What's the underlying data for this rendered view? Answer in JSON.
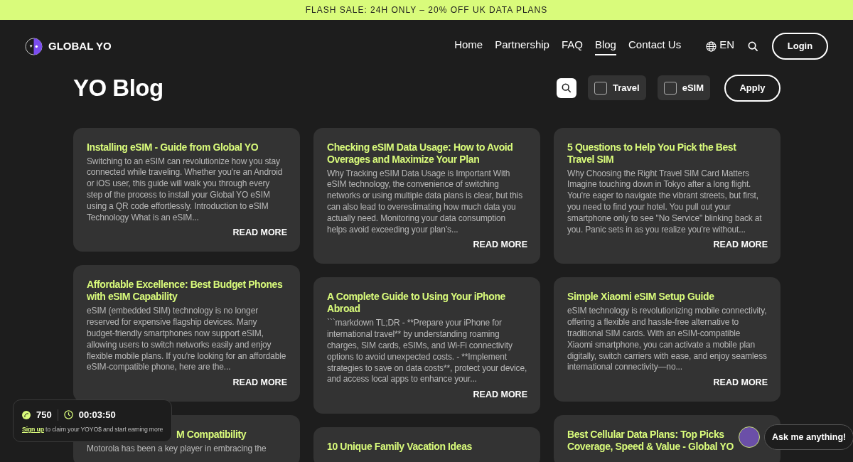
{
  "banner": {
    "text": "FLASH SALE: 24H ONLY – 20% OFF UK DATA PLANS"
  },
  "brand": {
    "name": "GLOBAL YO"
  },
  "nav": [
    {
      "label": "Home",
      "selected": false
    },
    {
      "label": "Partnership",
      "selected": false
    },
    {
      "label": "FAQ",
      "selected": false
    },
    {
      "label": "Blog",
      "selected": true
    },
    {
      "label": "Contact Us",
      "selected": false
    }
  ],
  "language": "EN",
  "login": "Login",
  "page_title": "YO Blog",
  "filters": [
    {
      "label": "Travel",
      "checked": false
    },
    {
      "label": "eSIM",
      "checked": false
    }
  ],
  "apply": "Apply",
  "posts": [
    {
      "title": "Installing eSIM - Guide from Global YO",
      "excerpt": "Switching to an eSIM can revolutionize how you stay connected while traveling. Whether you're an Android or iOS user, this guide will walk you through every step of the process to install your Global YO eSIM using a QR code effortlessly. Introduction to eSIM Technology What is an eSIM...",
      "link": "READ MORE"
    },
    {
      "title": "Checking eSIM Data Usage: How to Avoid Overages and Maximize Your Plan",
      "excerpt": "Why Tracking eSIM Data Usage is Important With eSIM technology, the convenience of switching networks or using multiple data plans is clear, but this can also lead to overestimating how much data you actually need. Monitoring your data consumption helps avoid exceeding your plan’s...",
      "link": "READ MORE"
    },
    {
      "title": "5 Questions to Help You Pick the Best Travel SIM",
      "excerpt": "Why Choosing the Right Travel SIM Card Matters Imagine touching down in Tokyo after a long flight. You're eager to navigate the vibrant streets, but first, you need to find your hotel. You pull out your smartphone only to see \"No Service\" blinking back at you. Panic sets in as you realize you're without...",
      "link": "READ MORE"
    },
    {
      "title": "Affordable Excellence: Best Budget Phones with eSIM Capability",
      "excerpt": "eSIM (embedded SIM) technology is no longer reserved for expensive flagship devices. Many budget-friendly smartphones now support eSIM, allowing users to switch networks easily and enjoy flexible mobile plans. If you're looking for an affordable eSIM-compatible phone, here are the...",
      "link": "READ MORE"
    },
    {
      "title": "A Complete Guide to Using Your iPhone Abroad",
      "excerpt": "```markdown TL;DR - **Prepare your iPhone for international travel** by understanding roaming charges, SIM cards, eSIMs, and Wi-Fi connectivity options to avoid unexpected costs. - **Implement strategies to save on data costs**, protect your device, and access local apps to enhance your...",
      "link": "READ MORE"
    },
    {
      "title": "Simple Xiaomi eSIM Setup Guide",
      "excerpt": "eSIM technology is revolutionizing mobile connectivity, offering a flexible and hassle-free alternative to traditional SIM cards. With an eSIM-compatible Xiaomi smartphone, you can activate a mobile plan digitally, switch carriers with ease, and enjoy seamless international connectivity—no...",
      "link": "READ MORE"
    },
    {
      "title": "M Compatibility",
      "excerpt": "Motorola has been a key player in embracing the",
      "partly_covered": true
    },
    {
      "title": "10 Unique Family Vacation Ideas"
    },
    {
      "title": "Best Cellular Data Plans: Top Picks Coverage, Speed & Value - Global YO"
    }
  ],
  "rewards": {
    "points": "750",
    "timer": "00:03:50",
    "signup_link": "Sign up",
    "signup_text": "to claim your YOYO$ and start earning more"
  },
  "chat": {
    "label": "Ask me anything!"
  }
}
